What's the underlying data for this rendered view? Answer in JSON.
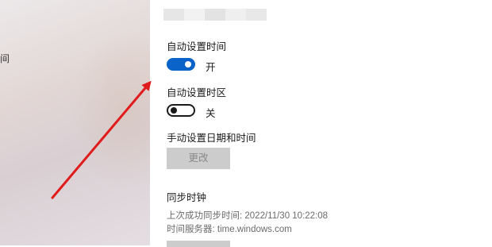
{
  "left_pane": {
    "clipped_text": "间"
  },
  "settings": {
    "auto_time": {
      "label": "自动设置时间",
      "state_text": "开",
      "on": true
    },
    "auto_timezone": {
      "label": "自动设置时区",
      "state_text": "关",
      "on": false
    },
    "manual": {
      "label": "手动设置日期和时间",
      "button_label": "更改"
    },
    "sync": {
      "heading": "同步时钟",
      "last_sync": "上次成功同步时间: 2022/11/30 10:22:08",
      "server": "时间服务器: time.windows.com"
    }
  },
  "colors": {
    "accent": "#0a63c9",
    "annotation_arrow": "#e01b1b",
    "disabled_button": "#cccccc",
    "secondary_text": "#6b6b6b"
  }
}
